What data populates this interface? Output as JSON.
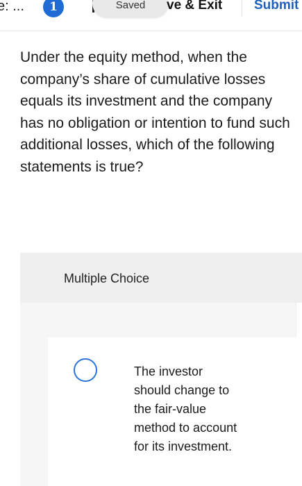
{
  "toolbar": {
    "cut_text": "e: ...",
    "question_badge": "1",
    "saved_label": "Saved",
    "save_exit_label": "ve & Exit",
    "submit_label": "Submit"
  },
  "question": {
    "text": "Under the equity method, when the company’s share of cumulative losses equals its investment and the company has no obligation or intention to fund such additional losses, which of the following statements is true?"
  },
  "multiple_choice": {
    "label": "Multiple Choice",
    "options": [
      {
        "text": "The investor should change to the fair-value method to account for its investment.",
        "selected": false
      }
    ]
  },
  "colors": {
    "accent": "#1f6bd6",
    "submit": "#1f5fb8",
    "radio_border": "#2a73d9",
    "panel_header": "#efefef",
    "panel_body": "#f6f6f6"
  }
}
